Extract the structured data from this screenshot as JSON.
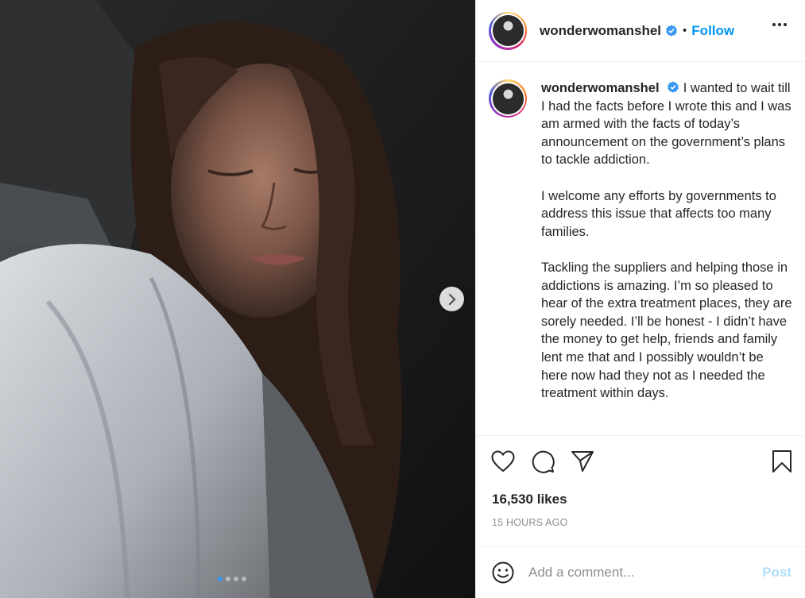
{
  "post": {
    "username": "wonderwomanshel",
    "verified": true,
    "follow_label": "Follow",
    "separator": "•",
    "caption_paragraphs": [
      "I wanted to wait till I had the facts before I wrote this and I was am armed with the facts of today’s announcement on the government’s plans to tackle addiction.",
      "I welcome any efforts by governments to address this issue that affects too many families.",
      "Tackling the suppliers and helping those in addictions is amazing. I’m so pleased to hear of the extra treatment places, they are sorely needed. I’ll be honest - I didn’t have the money to get help, friends and family lent me that and I possibly wouldn’t be here now had they not as I needed the treatment within days."
    ],
    "likes": "16,530 likes",
    "timestamp": "15 HOURS AGO",
    "carousel": {
      "count": 4,
      "active_index": 0
    }
  },
  "comment_box": {
    "placeholder": "Add a comment...",
    "post_label": "Post"
  },
  "icons": {
    "like": "heart-icon",
    "comment": "comment-bubble-icon",
    "share": "paper-plane-icon",
    "save": "bookmark-icon",
    "more": "more-horizontal-icon",
    "next": "chevron-right-icon",
    "emoji": "smiley-icon",
    "verified": "verified-badge-icon"
  },
  "colors": {
    "accent": "#0095f6",
    "verified": "#3897f0",
    "post_disabled": "#b2dffc",
    "muted": "#8e8e8e"
  }
}
